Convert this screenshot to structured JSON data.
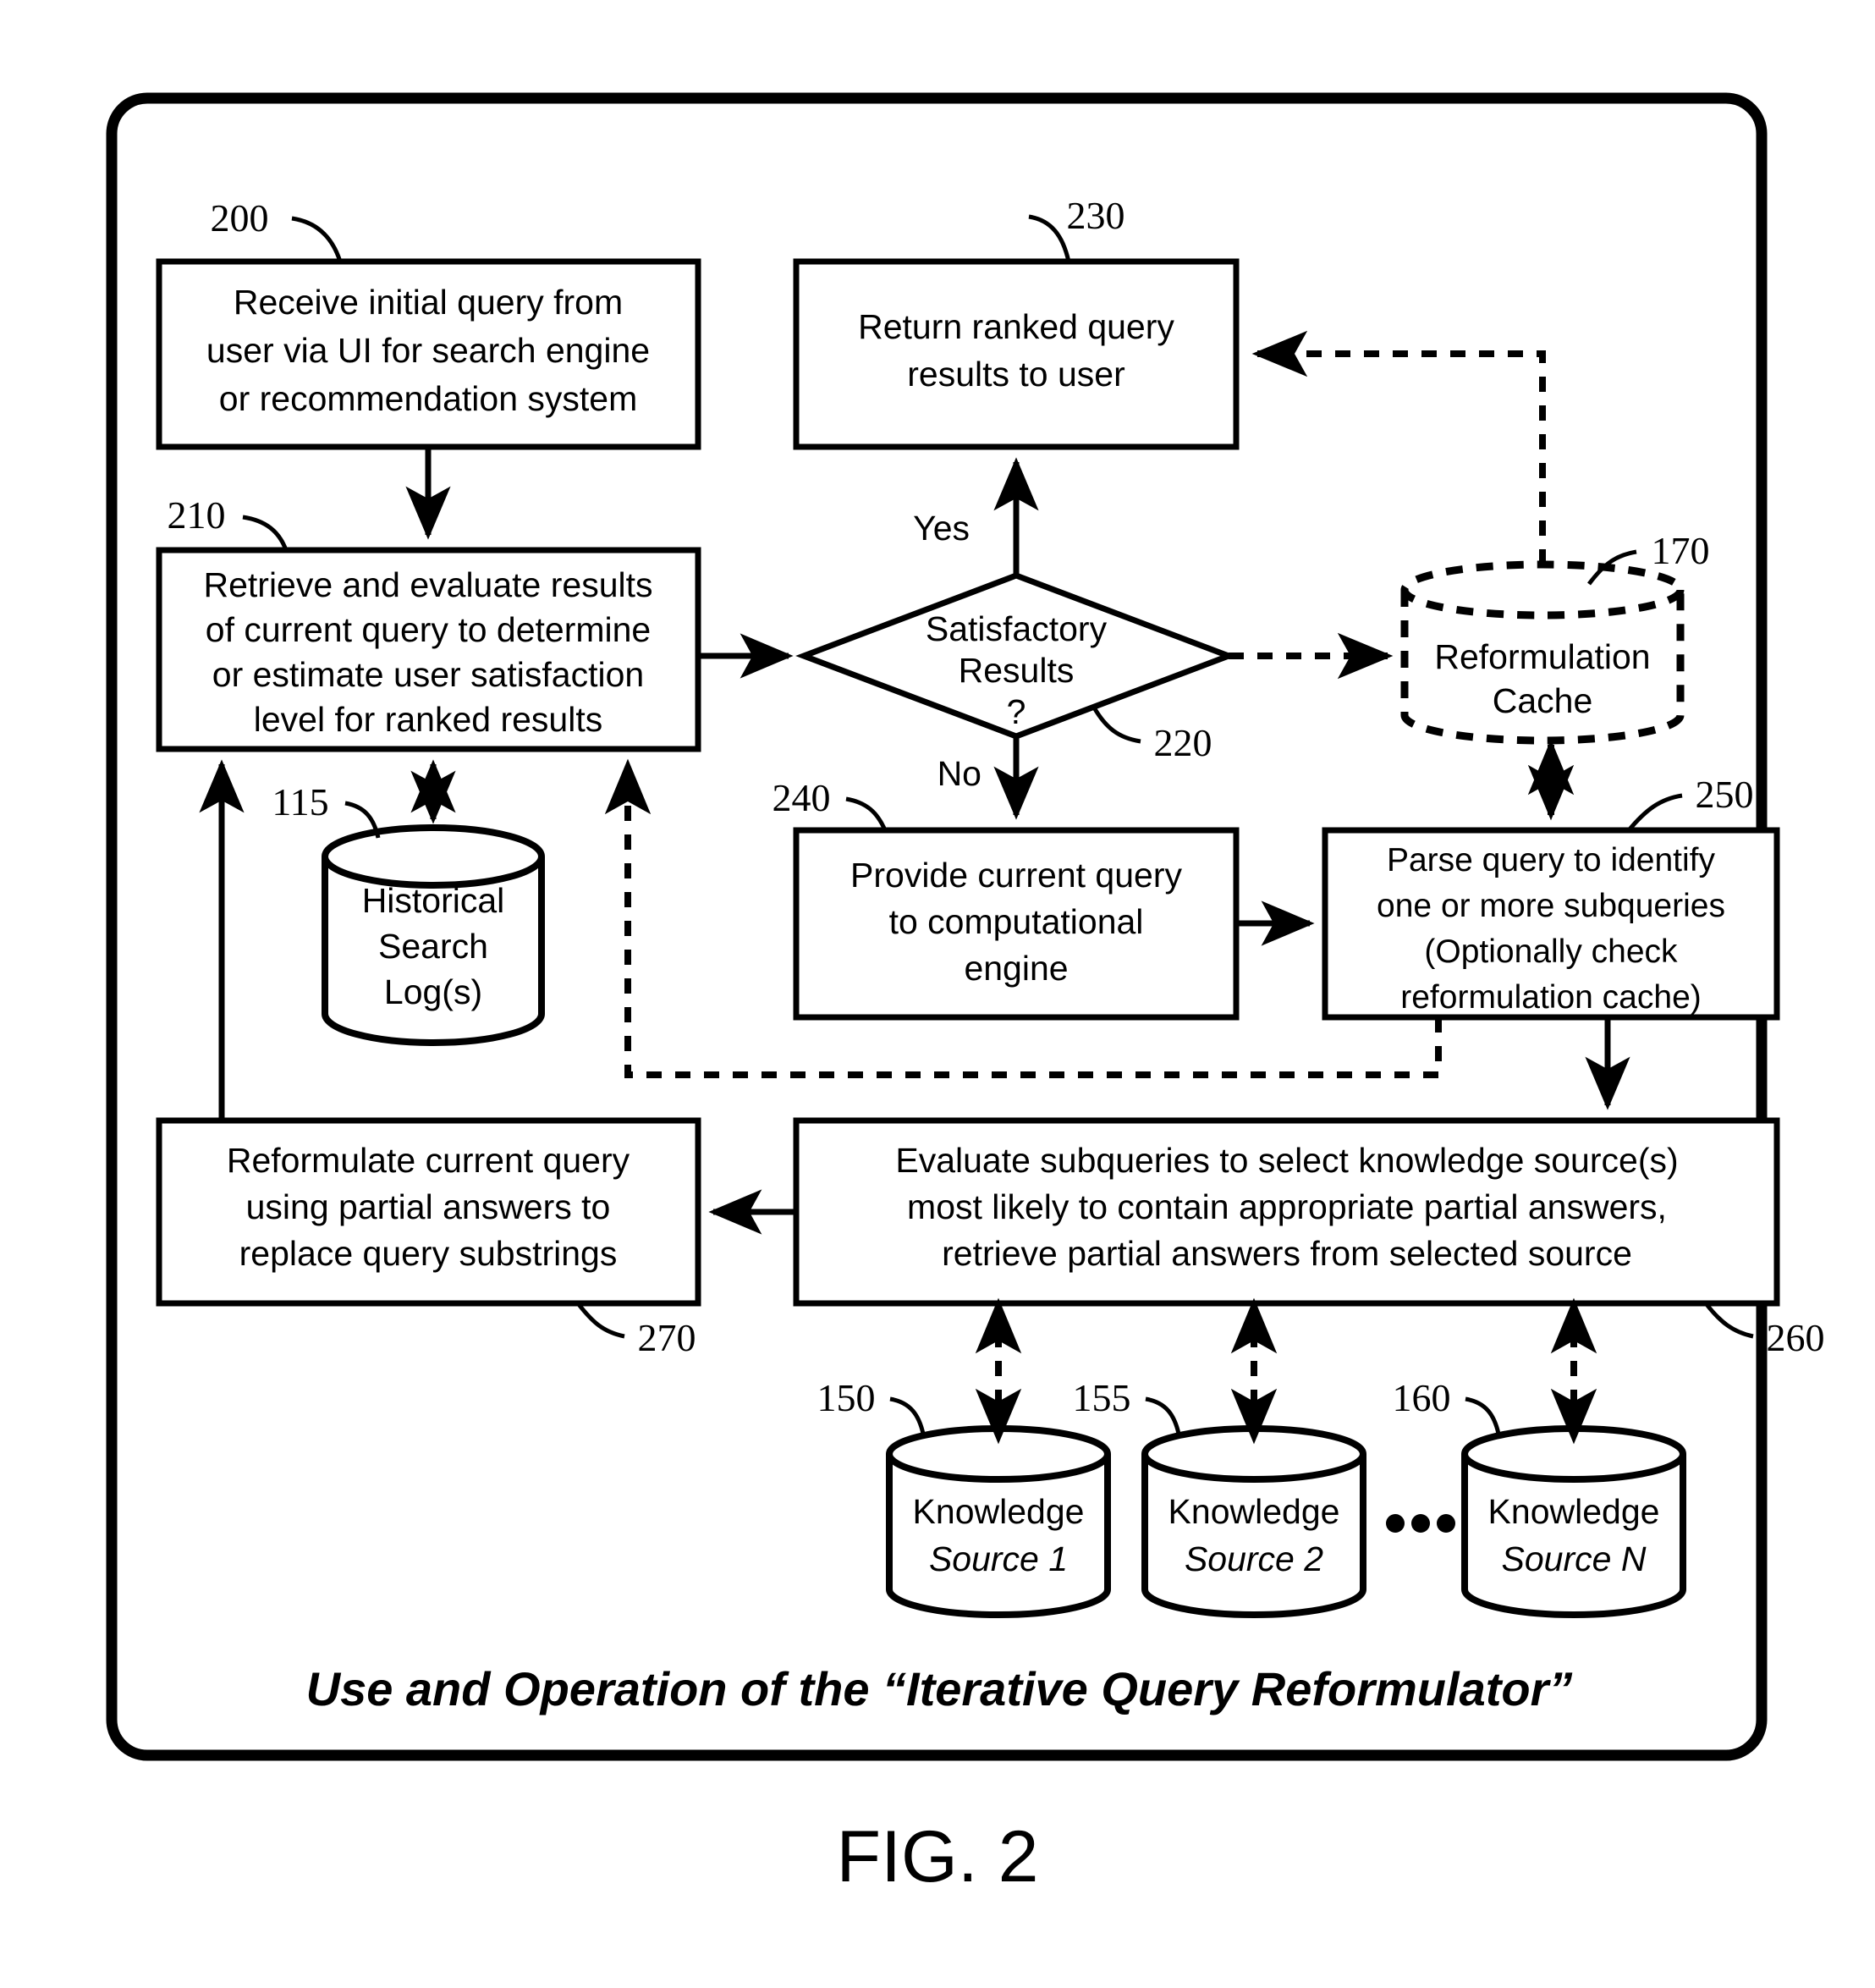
{
  "figure": {
    "label": "FIG. 2",
    "caption": "Use and Operation of the “Iterative Query Reformulator”"
  },
  "nodes": [
    {
      "id": "200",
      "ref": "200",
      "type": "process",
      "lines": [
        "Receive initial query from",
        "user via UI for search engine",
        "or recommendation system"
      ]
    },
    {
      "id": "210",
      "ref": "210",
      "type": "process",
      "lines": [
        "Retrieve and evaluate results",
        "of current query to determine",
        "or estimate user satisfaction",
        "level for ranked results"
      ]
    },
    {
      "id": "230",
      "ref": "230",
      "type": "process",
      "lines": [
        "Return ranked query",
        "results to user"
      ]
    },
    {
      "id": "220",
      "ref": "220",
      "type": "decision",
      "lines": [
        "Satisfactory",
        "Results",
        "?"
      ]
    },
    {
      "id": "240",
      "ref": "240",
      "type": "process",
      "lines": [
        "Provide current query",
        "to computational",
        "engine"
      ]
    },
    {
      "id": "250",
      "ref": "250",
      "type": "process",
      "lines": [
        "Parse query to identify",
        "one or more subqueries",
        "(Optionally check",
        "reformulation cache)"
      ]
    },
    {
      "id": "260",
      "ref": "260",
      "type": "process",
      "lines": [
        "Evaluate subqueries to select knowledge source(s)",
        "most likely to contain appropriate partial answers,",
        "retrieve partial answers from selected source"
      ]
    },
    {
      "id": "270",
      "ref": "270",
      "type": "process",
      "lines": [
        "Reformulate current query",
        "using partial answers to",
        "replace query substrings"
      ]
    },
    {
      "id": "115",
      "ref": "115",
      "type": "datastore",
      "lines": [
        "Historical",
        "Search",
        "Log(s)"
      ]
    },
    {
      "id": "170",
      "ref": "170",
      "type": "datastore-optional",
      "lines": [
        "Reformulation",
        "Cache"
      ]
    },
    {
      "id": "150",
      "ref": "150",
      "type": "datastore",
      "lines": [
        "Knowledge",
        "Source 1"
      ]
    },
    {
      "id": "155",
      "ref": "155",
      "type": "datastore",
      "lines": [
        "Knowledge",
        "Source 2"
      ]
    },
    {
      "id": "160",
      "ref": "160",
      "type": "datastore",
      "lines": [
        "Knowledge",
        "Source N"
      ]
    }
  ],
  "flow_labels": {
    "yes": "Yes",
    "no": "No",
    "ellipsis": "•••"
  },
  "colors": {
    "ink": "#000000",
    "paper": "#ffffff"
  }
}
